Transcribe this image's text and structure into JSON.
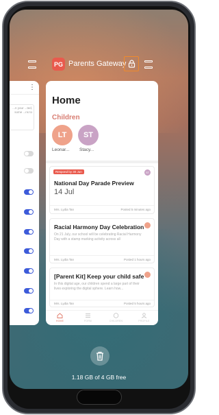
{
  "header": {
    "app_icon_text": "PG",
    "app_title": "Parents Gateway",
    "accent_color": "#e95a4d",
    "lock_highlight_color": "#f08a2c"
  },
  "left_card": {
    "kebab": "⋮",
    "info_text": "...n your ...ted, some ...ns to",
    "toggles": [
      false,
      false,
      true,
      true,
      true,
      true,
      true,
      true,
      true
    ]
  },
  "home": {
    "title": "Home",
    "children_label": "Children",
    "children": [
      {
        "initials": "LT",
        "name": "Leonar...",
        "color": "#efa28a"
      },
      {
        "initials": "ST",
        "name": "Stacy...",
        "color": "#c9a3c5"
      }
    ],
    "posts": [
      {
        "tag": "Respond by 30 Jun",
        "title": "National Day Parade Preview",
        "date": "14 Jul",
        "author": "Mrs. Lydia Tan",
        "posted": "Posted 5 minutes ago",
        "dot": "ST",
        "dot_color": "#c9a3c5"
      },
      {
        "title": "Racial Harmony Day Celebration",
        "body": "On 21 July, our school will be celebrating Racial Harmony Day with a stamp marking activity across all",
        "author": "Mrs. Lydia Tan",
        "posted": "Posted 1 hours ago",
        "dot": "",
        "dot_color": "#efa28a"
      },
      {
        "title": "[Parent Kit] Keep your child safe",
        "body": "In this digital age, our children spend a large part of their lives exploring the digital sphere. Learn how...",
        "author": "Mrs. Lydia Tan",
        "posted": "Posted 5 hours ago",
        "dot": "",
        "dot_color": "#efa28a"
      }
    ],
    "tabs": [
      {
        "label": "HOME",
        "icon": "home-icon",
        "active": true
      },
      {
        "label": "FORM",
        "icon": "list-icon",
        "active": false
      },
      {
        "label": "CHILDREN",
        "icon": "children-icon",
        "active": false
      },
      {
        "label": "PROFILE",
        "icon": "profile-icon",
        "active": false
      }
    ]
  },
  "footer": {
    "storage_text": "1.18 GB of 4 GB free"
  }
}
